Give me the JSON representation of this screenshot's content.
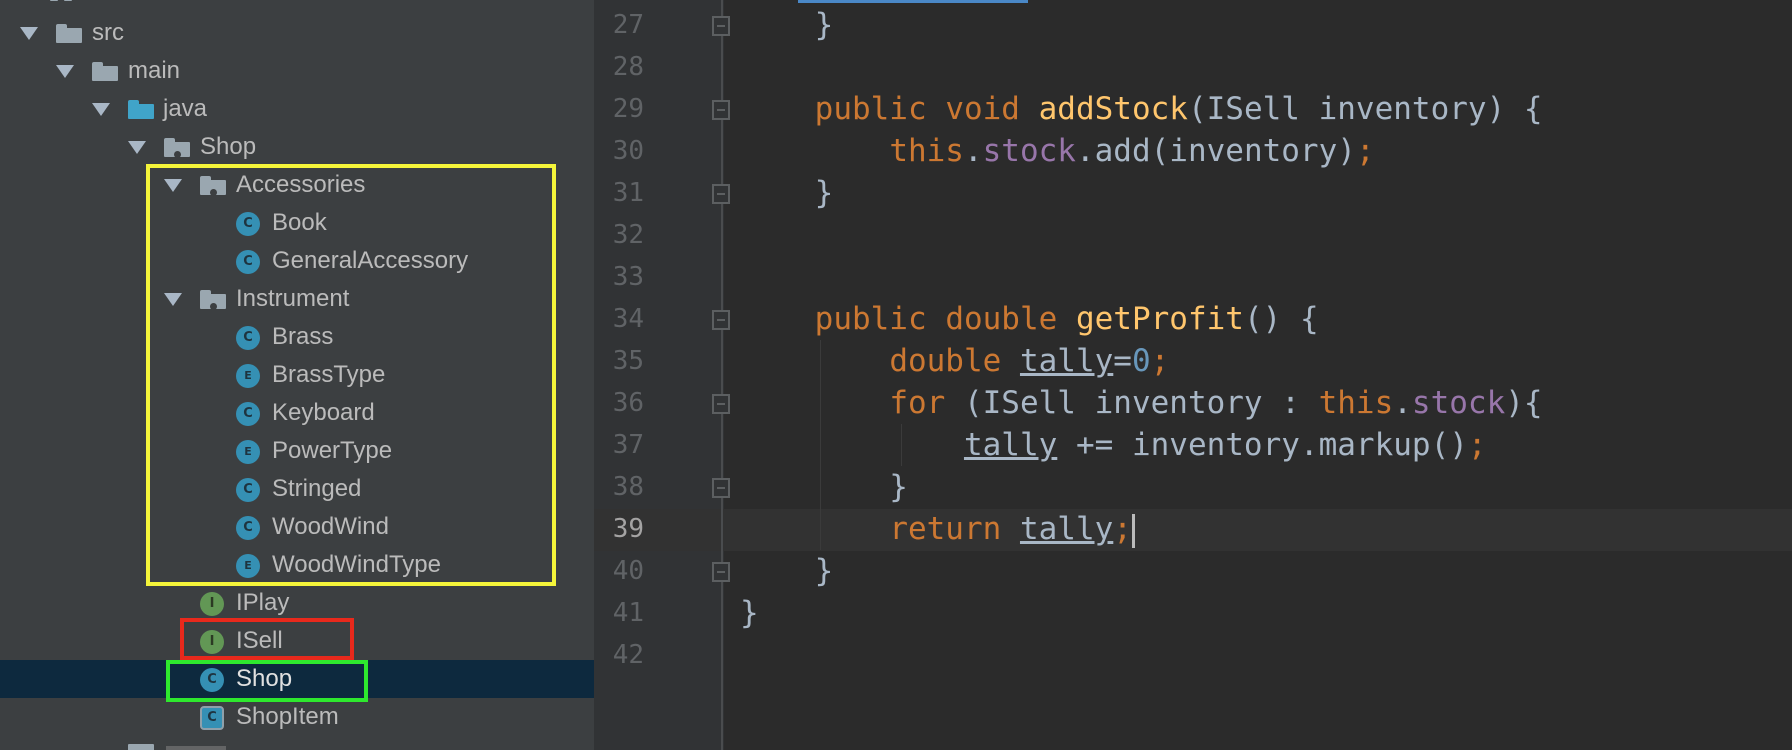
{
  "project_tree": {
    "items": [
      {
        "label": "src",
        "type": "folder"
      },
      {
        "label": "main",
        "type": "folder"
      },
      {
        "label": "java",
        "type": "source-folder"
      },
      {
        "label": "Shop",
        "type": "package"
      },
      {
        "label": "Accessories",
        "type": "package"
      },
      {
        "label": "Book",
        "type": "class",
        "icon_letter": "C"
      },
      {
        "label": "GeneralAccessory",
        "type": "class",
        "icon_letter": "C"
      },
      {
        "label": "Instrument",
        "type": "package"
      },
      {
        "label": "Brass",
        "type": "class",
        "icon_letter": "C"
      },
      {
        "label": "BrassType",
        "type": "enum",
        "icon_letter": "E"
      },
      {
        "label": "Keyboard",
        "type": "class",
        "icon_letter": "C"
      },
      {
        "label": "PowerType",
        "type": "enum",
        "icon_letter": "E"
      },
      {
        "label": "Stringed",
        "type": "class",
        "icon_letter": "C"
      },
      {
        "label": "WoodWind",
        "type": "class",
        "icon_letter": "C"
      },
      {
        "label": "WoodWindType",
        "type": "enum",
        "icon_letter": "E"
      },
      {
        "label": "IPlay",
        "type": "interface",
        "icon_letter": "I"
      },
      {
        "label": "ISell",
        "type": "interface",
        "icon_letter": "I"
      },
      {
        "label": "Shop",
        "type": "class",
        "icon_letter": "C",
        "selected": true
      },
      {
        "label": "ShopItem",
        "type": "abstract-class",
        "icon_letter": "C"
      }
    ]
  },
  "highlights": {
    "yellow": "#f5f53a",
    "red": "#e8291c",
    "green": "#2ee82e"
  },
  "editor": {
    "current_line": "39",
    "lines": [
      {
        "num": "27",
        "text": "    }"
      },
      {
        "num": "28",
        "text": ""
      },
      {
        "num": "29",
        "text": "    public void addStock(ISell inventory) {"
      },
      {
        "num": "30",
        "text": "        this.stock.add(inventory);"
      },
      {
        "num": "31",
        "text": "    }"
      },
      {
        "num": "32",
        "text": ""
      },
      {
        "num": "33",
        "text": ""
      },
      {
        "num": "34",
        "text": "    public double getProfit() {"
      },
      {
        "num": "35",
        "text": "        double tally=0;"
      },
      {
        "num": "36",
        "text": "        for (ISell inventory : this.stock){"
      },
      {
        "num": "37",
        "text": "            tally += inventory.markup();"
      },
      {
        "num": "38",
        "text": "        }"
      },
      {
        "num": "39",
        "text": "        return tally;"
      },
      {
        "num": "40",
        "text": "    }"
      },
      {
        "num": "41",
        "text": "}"
      },
      {
        "num": "42",
        "text": ""
      }
    ]
  },
  "colors": {
    "keyword": "#cc7832",
    "method": "#ffc66d",
    "field": "#9876aa",
    "number": "#6897bb",
    "text": "#a9b7c6",
    "selection": "#0d293e"
  }
}
